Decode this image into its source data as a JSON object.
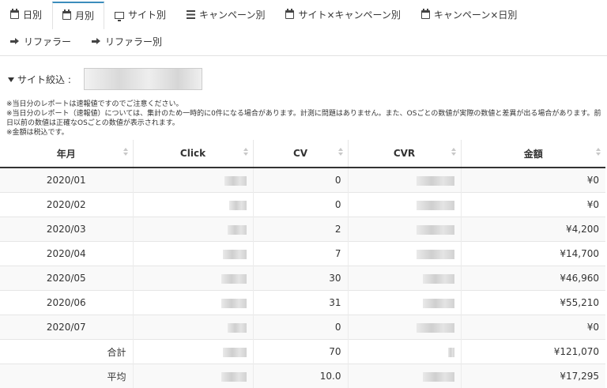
{
  "tabs": {
    "row1": [
      {
        "label": "日別",
        "icon": "calendar-icon",
        "active": false
      },
      {
        "label": "月別",
        "icon": "calendar-icon",
        "active": true
      },
      {
        "label": "サイト別",
        "icon": "monitor-icon",
        "active": false
      },
      {
        "label": "キャンペーン別",
        "icon": "list-icon",
        "active": false
      },
      {
        "label": "サイト×キャンペーン別",
        "icon": "calendar-icon",
        "active": false
      },
      {
        "label": "キャンペーン×日別",
        "icon": "calendar-icon",
        "active": false
      }
    ],
    "row2": [
      {
        "label": "リファラー",
        "icon": "sign-in-icon",
        "active": false
      },
      {
        "label": "リファラー別",
        "icon": "sign-in-icon",
        "active": false
      }
    ]
  },
  "filter": {
    "label": "サイト絞込 :",
    "icon": "funnel-icon",
    "value": ""
  },
  "notes": [
    "※当日分のレポートは速報値ですのでご注意ください。",
    "※当日分のレポート（速報値）については、集計のため一時的に0件になる場合があります。計測に問題はありません。また、OSごとの数値が実際の数値と差異が出る場合があります。前日以前の数値は正確なOSごとの数値が表示されます。",
    "※金額は税込です。"
  ],
  "table": {
    "headers": [
      "年月",
      "Click",
      "CV",
      "CVR",
      "金額"
    ],
    "rows": [
      {
        "month": "2020/01",
        "cv": "0",
        "amount": "¥0"
      },
      {
        "month": "2020/02",
        "cv": "0",
        "amount": "¥0"
      },
      {
        "month": "2020/03",
        "cv": "2",
        "amount": "¥4,200"
      },
      {
        "month": "2020/04",
        "cv": "7",
        "amount": "¥14,700"
      },
      {
        "month": "2020/05",
        "cv": "30",
        "amount": "¥46,960"
      },
      {
        "month": "2020/06",
        "cv": "31",
        "amount": "¥55,210"
      },
      {
        "month": "2020/07",
        "cv": "0",
        "amount": "¥0"
      }
    ],
    "total": {
      "label": "合計",
      "cv": "70",
      "amount": "¥121,070"
    },
    "average": {
      "label": "平均",
      "cv": "10.0",
      "amount": "¥17,295"
    }
  },
  "colors": {
    "active_tab_accent": "#3c8dbc",
    "header_rule": "#333333",
    "stripe": "#f9f9f9"
  }
}
